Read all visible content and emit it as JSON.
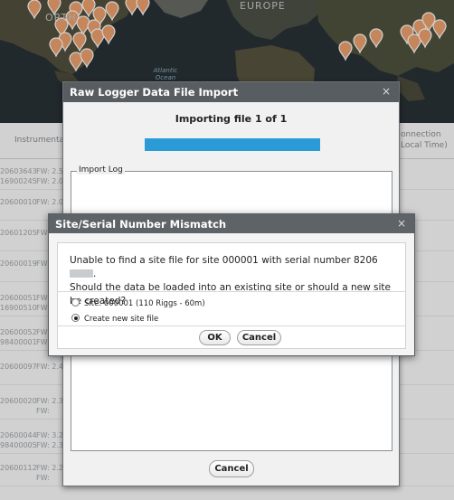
{
  "map": {
    "labels": {
      "region": "EUROPE",
      "ocean": "Atlantic Ocean",
      "partial_region": "ORTH"
    },
    "pin_color": "#f1a46f"
  },
  "background_table": {
    "headers": {
      "instrumentation": "Instrumentatio",
      "connection": "onnection",
      "local_time": "Local Time)"
    },
    "rows": [
      {
        "serial": "20603643\n16900245",
        "fw": "FW: 2.5\nFW: 2.0"
      },
      {
        "serial": "20600010",
        "fw": "FW: 2.0"
      },
      {
        "serial": "20601205",
        "fw": "FW:"
      },
      {
        "serial": "20600019",
        "fw": "FW:"
      },
      {
        "serial": "20600051\n16900510",
        "fw": "FW:\nFW:"
      },
      {
        "serial": "20600052\n98400001",
        "fw": "FW:\nFW:"
      },
      {
        "serial": "20600097",
        "fw": "FW: 2.4"
      },
      {
        "serial": "20600020",
        "fw": "FW: 2.3\nFW:"
      },
      {
        "serial": "20600044\n98400005",
        "fw": "FW: 3.2\nFW: 2.3"
      },
      {
        "serial": "20600112",
        "fw": "FW: 2.2\nFW:"
      }
    ]
  },
  "import_dialog": {
    "title": "Raw Logger Data File Import",
    "close_glyph": "×",
    "status": "Importing file 1 of 1",
    "progress": 1.0,
    "progress_color": "#2b9bd8",
    "log_legend": "Import Log",
    "cancel_label": "Cancel"
  },
  "mismatch_dialog": {
    "title": "Site/Serial Number Mismatch",
    "close_glyph": "×",
    "message_line1": "Unable to find a site file for site 000001 with serial number 8206",
    "message_line1_end": ".",
    "message_line2": "Should the data be loaded into an existing site or should a new site be created?",
    "options": [
      {
        "label": "Site: 000001 (110 Riggs - 60m)",
        "selected": false
      },
      {
        "label": "Create new site file",
        "selected": true
      }
    ],
    "ok_label": "OK",
    "cancel_label": "Cancel"
  }
}
